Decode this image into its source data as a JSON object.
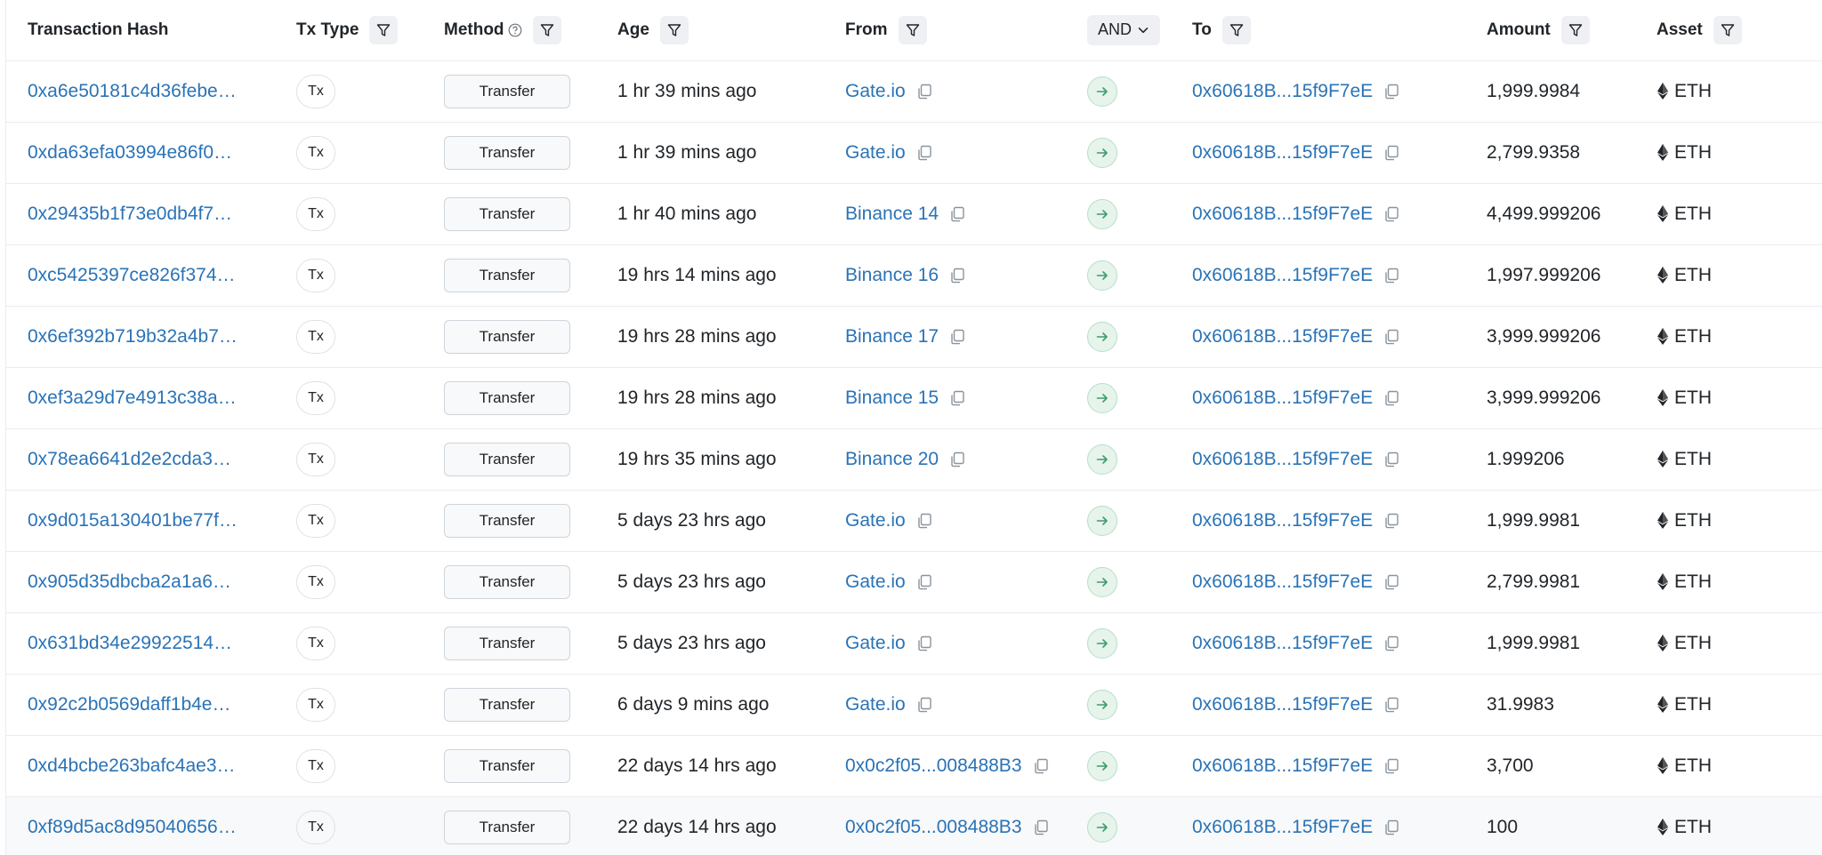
{
  "headers": {
    "hash": "Transaction Hash",
    "txtype": "Tx Type",
    "method": "Method",
    "age": "Age",
    "from": "From",
    "and_label": "AND",
    "to": "To",
    "amount": "Amount",
    "asset": "Asset"
  },
  "icons": {
    "filter": "filter-icon",
    "help": "question-circle-icon",
    "chevron": "chevron-down-icon",
    "copy": "copy-icon",
    "arrow": "arrow-right-icon",
    "eth": "ethereum-icon"
  },
  "colors": {
    "link": "#2a73b6",
    "arrow_green": "#3c9d67",
    "arrow_bg": "#e6f4ec"
  },
  "rows": [
    {
      "hash": "0xa6e50181c4d36febe…",
      "txtype": "Tx",
      "method": "Transfer",
      "age": "1 hr 39 mins ago",
      "from": "Gate.io",
      "to": "0x60618B...15f9F7eE",
      "amount": "1,999.9984",
      "asset": "ETH"
    },
    {
      "hash": "0xda63efa03994e86f0…",
      "txtype": "Tx",
      "method": "Transfer",
      "age": "1 hr 39 mins ago",
      "from": "Gate.io",
      "to": "0x60618B...15f9F7eE",
      "amount": "2,799.9358",
      "asset": "ETH"
    },
    {
      "hash": "0x29435b1f73e0db4f7…",
      "txtype": "Tx",
      "method": "Transfer",
      "age": "1 hr 40 mins ago",
      "from": "Binance 14",
      "to": "0x60618B...15f9F7eE",
      "amount": "4,499.999206",
      "asset": "ETH"
    },
    {
      "hash": "0xc5425397ce826f374…",
      "txtype": "Tx",
      "method": "Transfer",
      "age": "19 hrs 14 mins ago",
      "from": "Binance 16",
      "to": "0x60618B...15f9F7eE",
      "amount": "1,997.999206",
      "asset": "ETH"
    },
    {
      "hash": "0x6ef392b719b32a4b7…",
      "txtype": "Tx",
      "method": "Transfer",
      "age": "19 hrs 28 mins ago",
      "from": "Binance 17",
      "to": "0x60618B...15f9F7eE",
      "amount": "3,999.999206",
      "asset": "ETH"
    },
    {
      "hash": "0xef3a29d7e4913c38a…",
      "txtype": "Tx",
      "method": "Transfer",
      "age": "19 hrs 28 mins ago",
      "from": "Binance 15",
      "to": "0x60618B...15f9F7eE",
      "amount": "3,999.999206",
      "asset": "ETH"
    },
    {
      "hash": "0x78ea6641d2e2cda3…",
      "txtype": "Tx",
      "method": "Transfer",
      "age": "19 hrs 35 mins ago",
      "from": "Binance 20",
      "to": "0x60618B...15f9F7eE",
      "amount": "1.999206",
      "asset": "ETH"
    },
    {
      "hash": "0x9d015a130401be77f…",
      "txtype": "Tx",
      "method": "Transfer",
      "age": "5 days 23 hrs ago",
      "from": "Gate.io",
      "to": "0x60618B...15f9F7eE",
      "amount": "1,999.9981",
      "asset": "ETH"
    },
    {
      "hash": "0x905d35dbcba2a1a6…",
      "txtype": "Tx",
      "method": "Transfer",
      "age": "5 days 23 hrs ago",
      "from": "Gate.io",
      "to": "0x60618B...15f9F7eE",
      "amount": "2,799.9981",
      "asset": "ETH"
    },
    {
      "hash": "0x631bd34e29922514…",
      "txtype": "Tx",
      "method": "Transfer",
      "age": "5 days 23 hrs ago",
      "from": "Gate.io",
      "to": "0x60618B...15f9F7eE",
      "amount": "1,999.9981",
      "asset": "ETH"
    },
    {
      "hash": "0x92c2b0569daff1b4e…",
      "txtype": "Tx",
      "method": "Transfer",
      "age": "6 days 9 mins ago",
      "from": "Gate.io",
      "to": "0x60618B...15f9F7eE",
      "amount": "31.9983",
      "asset": "ETH"
    },
    {
      "hash": "0xd4bcbe263bafc4ae3…",
      "txtype": "Tx",
      "method": "Transfer",
      "age": "22 days 14 hrs ago",
      "from": "0x0c2f05...008488B3",
      "to": "0x60618B...15f9F7eE",
      "amount": "3,700",
      "asset": "ETH"
    },
    {
      "hash": "0xf89d5ac8d95040656…",
      "txtype": "Tx",
      "method": "Transfer",
      "age": "22 days 14 hrs ago",
      "from": "0x0c2f05...008488B3",
      "to": "0x60618B...15f9F7eE",
      "amount": "100",
      "asset": "ETH"
    }
  ]
}
